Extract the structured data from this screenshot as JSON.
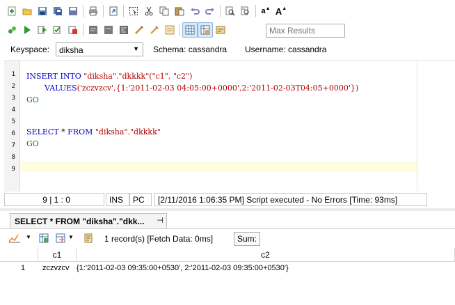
{
  "toolbar1": {
    "icons": [
      "new-file-icon",
      "open-folder-icon",
      "save-icon",
      "save-all-icon",
      "save-as-icon",
      "print-icon",
      "export-icon",
      "select-all-icon",
      "cut-icon",
      "copy-icon",
      "paste-icon",
      "undo-icon",
      "redo-icon",
      "find-icon",
      "replace-icon",
      "font-increase-icon",
      "font-decrease-icon"
    ],
    "font_increase": "a",
    "font_decrease": "A"
  },
  "toolbar2": {
    "icons": [
      "execute-all-icon",
      "execute-icon",
      "execute-step-icon",
      "execute-current-icon",
      "stop-icon",
      "toggle-comment-icon",
      "uncomment-icon",
      "format-icon",
      "indent-icon",
      "clear-icon",
      "results-grid-icon",
      "results-text-icon",
      "results-form-icon"
    ],
    "max_results_placeholder": "Max Results"
  },
  "keyspace_bar": {
    "keyspace_label": "Keyspace:",
    "keyspace_value": "diksha",
    "schema_text": "Schema:  cassandra",
    "username_text": "Username:  cassandra"
  },
  "editor": {
    "line_numbers": [
      "1",
      "2",
      "3",
      "4",
      "5",
      "6",
      "7",
      "8",
      "9"
    ],
    "line2": {
      "kw1": "INSERT",
      "kw2": "INTO",
      "table": "\"diksha\".\"dkkkk\"",
      "cols": "(\"c1\", \"c2\")"
    },
    "line3": {
      "kw": "VALUES",
      "vals": "('zczvzcv',{1:'2011-02-03 04:05:00+0000',2:'2011-02-03T04:05+0000'})"
    },
    "line4": {
      "go": "GO"
    },
    "line7": {
      "kw1": "SELECT",
      "star": "*",
      "kw2": "FROM",
      "table": "\"diksha\".\"dkkkk\""
    },
    "line8": {
      "go": "GO"
    }
  },
  "statusbar": {
    "position": "9 | 1 : 0",
    "mode": "INS",
    "platform": "PC",
    "message": "[2/11/2016 1:06:35 PM] Script executed - No Errors [Time: 93ms]"
  },
  "result_tab": {
    "label": "SELECT * FROM \"diksha\".\"dkk...",
    "pin": "⊣"
  },
  "result_toolbar": {
    "records": "1 record(s) [Fetch Data: 0ms]",
    "sum_label": "Sum:"
  },
  "grid": {
    "columns": [
      "c1",
      "c2"
    ],
    "rows": [
      {
        "row_num": "1",
        "c1": "zczvzcv",
        "c2": "{1:'2011-02-03 09:35:00+0530', 2:'2011-02-03 09:35:00+0530'}"
      }
    ]
  }
}
